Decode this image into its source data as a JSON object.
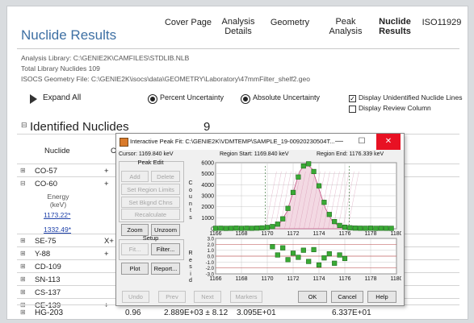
{
  "header": {
    "title": "Nuclide Results",
    "tabs": [
      {
        "label_lines": [
          "Cover Page"
        ],
        "active": false
      },
      {
        "label_lines": [
          "Analysis",
          "Details"
        ],
        "active": false
      },
      {
        "label_lines": [
          "Geometry"
        ],
        "active": false
      },
      {
        "label_lines": [
          "Peak",
          "Analysis"
        ],
        "active": false
      },
      {
        "label_lines": [
          "Nuclide",
          "Results"
        ],
        "active": true
      },
      {
        "label_lines": [
          "ISO11929"
        ],
        "active": false
      }
    ]
  },
  "info": {
    "analysis_library": "Analysis Library: C:\\GENIE2K\\CAMFILES\\STDLIB.NLB",
    "total_library": "Total Library Nuclides 109",
    "isocs_geometry": "ISOCS Geometry File: C:\\GENIE2K\\isocs\\data\\GEOMETRY\\Laboratory\\47mmFilter_shelf2.geo"
  },
  "options": {
    "expand_all": "Expand All",
    "percent_uncertainty": "Percent Uncertainty",
    "absolute_uncertainty": "Absolute Uncertainty",
    "display_unidentified": "Display Unidentified Nuclide Lines",
    "display_review": "Display Review Column",
    "display_unidentified_checked": true,
    "display_review_checked": false
  },
  "section": {
    "toggle": "⊟",
    "title": "Identified Nuclides",
    "count": "9",
    "column_nuclide": "Nuclide",
    "column_c": "C"
  },
  "nuclides": [
    {
      "exp": "⊞",
      "name": "CO-57",
      "plus": "+"
    },
    {
      "exp": "⊟",
      "name": "CO-60",
      "plus": "+"
    },
    {
      "exp": "⊞",
      "name": "SE-75",
      "plus": "X+"
    },
    {
      "exp": "⊞",
      "name": "Y-88",
      "plus": "+"
    },
    {
      "exp": "⊞",
      "name": "CD-109",
      "plus": ""
    },
    {
      "exp": "⊞",
      "name": "SN-113",
      "plus": ""
    },
    {
      "exp": "⊞",
      "name": "CS-137",
      "plus": ""
    },
    {
      "exp": "⊞",
      "name": "CE-139",
      "plus": "+"
    }
  ],
  "co60_detail": {
    "energy_label": "Energy",
    "energy_unit": "(keV)",
    "lines": [
      "1173.22*",
      "1332.49*"
    ]
  },
  "last_row": {
    "exp": "⊞",
    "name": "HG-203",
    "col1": "0.96",
    "col2": "2.889E+03 ± 8.12",
    "col3": "3.095E+01",
    "col4": "6.337E+01"
  },
  "dialog": {
    "title": "Interactive Peak Fit: C:\\GENIE2K\\VDMTEMP\\SAMPLE_19-00920230504T...",
    "minimize": "—",
    "maximize": "☐",
    "close": "✕",
    "cursor": "Cursor:       1169.840 keV",
    "region_start": "Region Start:       1169.840 keV",
    "region_end": "Region End:       1176.339 keV",
    "peak_edit_label": "Peak Edit",
    "add": "Add",
    "delete": "Delete",
    "set_region_limits": "Set Region Limits",
    "set_bkgnd_chns": "Set Bkgnd Chns",
    "recalculate": "Recalculate",
    "zoom": "Zoom",
    "unzoom": "Unzoom",
    "setup_label": "Setup",
    "fit": "Fit...",
    "filter": "Filter...",
    "plot": "Plot",
    "report": "Report...",
    "undo": "Undo",
    "prev": "Prev",
    "next": "Next",
    "markers": "Markers",
    "ok": "OK",
    "cancel": "Cancel",
    "help": "Help",
    "counts_axis_letters": [
      "C",
      "o",
      "u",
      "n",
      "t",
      "s"
    ],
    "resid_axis_letters": [
      "R",
      "e",
      "s",
      "i",
      "d"
    ]
  },
  "chart_data": [
    {
      "type": "scatter",
      "title": "",
      "xlim": [
        1166,
        1180
      ],
      "ylim": [
        0,
        6000
      ],
      "x_ticks": [
        1166,
        1168,
        1170,
        1172,
        1174,
        1176,
        1178,
        1180
      ],
      "y_ticks": [
        0,
        1000,
        2000,
        3000,
        4000,
        5000,
        6000
      ],
      "ylabel": "Counts",
      "region": [
        1169.84,
        1176.339
      ],
      "points_x": [
        1166.0,
        1166.4,
        1166.8,
        1167.2,
        1167.6,
        1168.0,
        1168.4,
        1168.8,
        1169.2,
        1169.6,
        1170.0,
        1170.4,
        1170.8,
        1171.2,
        1171.6,
        1172.0,
        1172.4,
        1172.8,
        1173.2,
        1173.6,
        1174.0,
        1174.4,
        1174.8,
        1175.2,
        1175.6,
        1176.0,
        1176.4,
        1176.8,
        1177.2,
        1177.6,
        1178.0,
        1178.4,
        1178.8,
        1179.2,
        1179.6
      ],
      "points_y": [
        40,
        50,
        35,
        45,
        60,
        40,
        55,
        45,
        60,
        80,
        120,
        200,
        420,
        900,
        1850,
        3300,
        4700,
        5700,
        5900,
        5200,
        3900,
        2400,
        1300,
        650,
        300,
        140,
        90,
        60,
        50,
        45,
        55,
        40,
        50,
        45,
        40
      ],
      "fit_x": [
        1169.84,
        1170.5,
        1171.0,
        1171.5,
        1172.0,
        1172.5,
        1173.0,
        1173.5,
        1174.0,
        1174.5,
        1175.0,
        1175.5,
        1176.0,
        1176.339
      ],
      "fit_y": [
        60,
        180,
        550,
        1500,
        3300,
        5200,
        5950,
        5400,
        3600,
        1850,
        750,
        250,
        110,
        60
      ]
    },
    {
      "type": "scatter",
      "title": "",
      "xlim": [
        1166,
        1180
      ],
      "ylim": [
        -3.0,
        3.0
      ],
      "x_ticks": [
        1166,
        1168,
        1170,
        1172,
        1174,
        1176,
        1178,
        1180
      ],
      "y_ticks": [
        -3.0,
        -2.0,
        -1.0,
        0.0,
        1.0,
        2.0,
        3.0
      ],
      "ylabel": "Resid",
      "points_x": [
        1170.4,
        1170.8,
        1171.2,
        1171.6,
        1172.0,
        1172.4,
        1172.8,
        1173.2,
        1173.6,
        1174.0,
        1174.4,
        1174.8,
        1175.2,
        1175.6,
        1176.0
      ],
      "points_y": [
        1.6,
        0.2,
        1.4,
        -0.6,
        0.5,
        -0.2,
        1.0,
        -0.9,
        1.1,
        -1.5,
        -0.3,
        0.4,
        -1.2,
        0.2,
        -0.4
      ]
    }
  ]
}
